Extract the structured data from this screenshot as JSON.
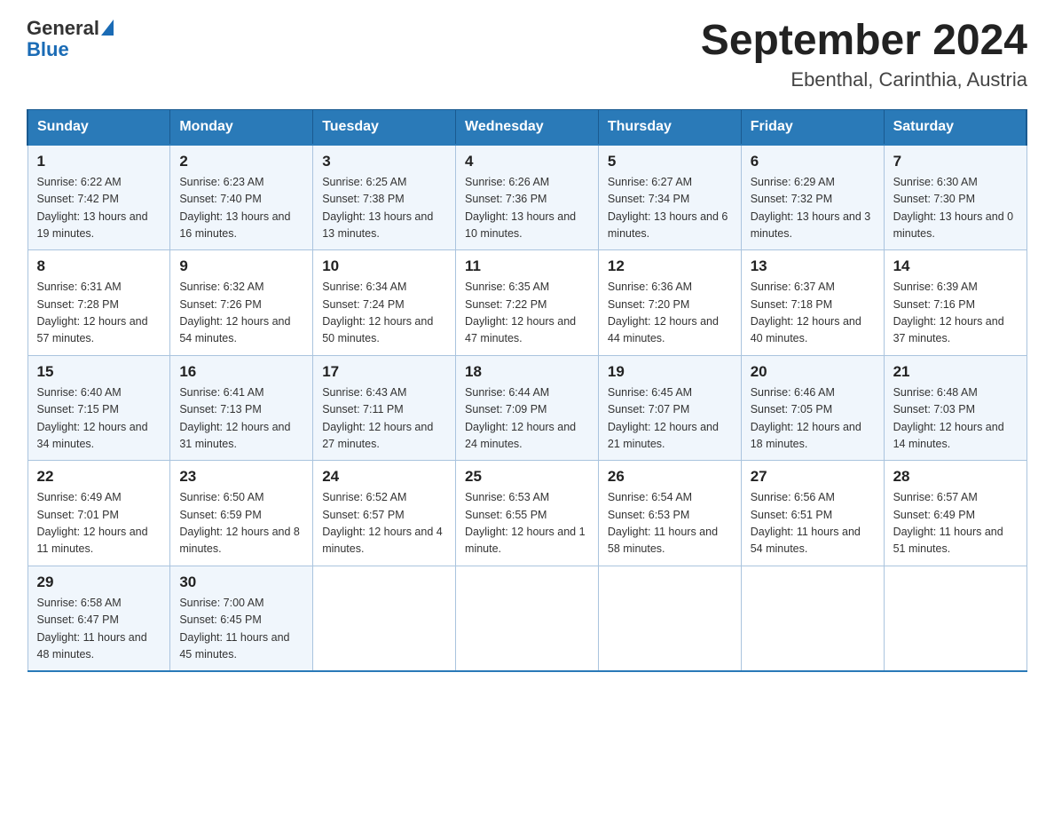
{
  "header": {
    "logo_general": "General",
    "logo_blue": "Blue",
    "title": "September 2024",
    "subtitle": "Ebenthal, Carinthia, Austria"
  },
  "days_of_week": [
    "Sunday",
    "Monday",
    "Tuesday",
    "Wednesday",
    "Thursday",
    "Friday",
    "Saturday"
  ],
  "weeks": [
    [
      {
        "day": "1",
        "sunrise": "Sunrise: 6:22 AM",
        "sunset": "Sunset: 7:42 PM",
        "daylight": "Daylight: 13 hours and 19 minutes."
      },
      {
        "day": "2",
        "sunrise": "Sunrise: 6:23 AM",
        "sunset": "Sunset: 7:40 PM",
        "daylight": "Daylight: 13 hours and 16 minutes."
      },
      {
        "day": "3",
        "sunrise": "Sunrise: 6:25 AM",
        "sunset": "Sunset: 7:38 PM",
        "daylight": "Daylight: 13 hours and 13 minutes."
      },
      {
        "day": "4",
        "sunrise": "Sunrise: 6:26 AM",
        "sunset": "Sunset: 7:36 PM",
        "daylight": "Daylight: 13 hours and 10 minutes."
      },
      {
        "day": "5",
        "sunrise": "Sunrise: 6:27 AM",
        "sunset": "Sunset: 7:34 PM",
        "daylight": "Daylight: 13 hours and 6 minutes."
      },
      {
        "day": "6",
        "sunrise": "Sunrise: 6:29 AM",
        "sunset": "Sunset: 7:32 PM",
        "daylight": "Daylight: 13 hours and 3 minutes."
      },
      {
        "day": "7",
        "sunrise": "Sunrise: 6:30 AM",
        "sunset": "Sunset: 7:30 PM",
        "daylight": "Daylight: 13 hours and 0 minutes."
      }
    ],
    [
      {
        "day": "8",
        "sunrise": "Sunrise: 6:31 AM",
        "sunset": "Sunset: 7:28 PM",
        "daylight": "Daylight: 12 hours and 57 minutes."
      },
      {
        "day": "9",
        "sunrise": "Sunrise: 6:32 AM",
        "sunset": "Sunset: 7:26 PM",
        "daylight": "Daylight: 12 hours and 54 minutes."
      },
      {
        "day": "10",
        "sunrise": "Sunrise: 6:34 AM",
        "sunset": "Sunset: 7:24 PM",
        "daylight": "Daylight: 12 hours and 50 minutes."
      },
      {
        "day": "11",
        "sunrise": "Sunrise: 6:35 AM",
        "sunset": "Sunset: 7:22 PM",
        "daylight": "Daylight: 12 hours and 47 minutes."
      },
      {
        "day": "12",
        "sunrise": "Sunrise: 6:36 AM",
        "sunset": "Sunset: 7:20 PM",
        "daylight": "Daylight: 12 hours and 44 minutes."
      },
      {
        "day": "13",
        "sunrise": "Sunrise: 6:37 AM",
        "sunset": "Sunset: 7:18 PM",
        "daylight": "Daylight: 12 hours and 40 minutes."
      },
      {
        "day": "14",
        "sunrise": "Sunrise: 6:39 AM",
        "sunset": "Sunset: 7:16 PM",
        "daylight": "Daylight: 12 hours and 37 minutes."
      }
    ],
    [
      {
        "day": "15",
        "sunrise": "Sunrise: 6:40 AM",
        "sunset": "Sunset: 7:15 PM",
        "daylight": "Daylight: 12 hours and 34 minutes."
      },
      {
        "day": "16",
        "sunrise": "Sunrise: 6:41 AM",
        "sunset": "Sunset: 7:13 PM",
        "daylight": "Daylight: 12 hours and 31 minutes."
      },
      {
        "day": "17",
        "sunrise": "Sunrise: 6:43 AM",
        "sunset": "Sunset: 7:11 PM",
        "daylight": "Daylight: 12 hours and 27 minutes."
      },
      {
        "day": "18",
        "sunrise": "Sunrise: 6:44 AM",
        "sunset": "Sunset: 7:09 PM",
        "daylight": "Daylight: 12 hours and 24 minutes."
      },
      {
        "day": "19",
        "sunrise": "Sunrise: 6:45 AM",
        "sunset": "Sunset: 7:07 PM",
        "daylight": "Daylight: 12 hours and 21 minutes."
      },
      {
        "day": "20",
        "sunrise": "Sunrise: 6:46 AM",
        "sunset": "Sunset: 7:05 PM",
        "daylight": "Daylight: 12 hours and 18 minutes."
      },
      {
        "day": "21",
        "sunrise": "Sunrise: 6:48 AM",
        "sunset": "Sunset: 7:03 PM",
        "daylight": "Daylight: 12 hours and 14 minutes."
      }
    ],
    [
      {
        "day": "22",
        "sunrise": "Sunrise: 6:49 AM",
        "sunset": "Sunset: 7:01 PM",
        "daylight": "Daylight: 12 hours and 11 minutes."
      },
      {
        "day": "23",
        "sunrise": "Sunrise: 6:50 AM",
        "sunset": "Sunset: 6:59 PM",
        "daylight": "Daylight: 12 hours and 8 minutes."
      },
      {
        "day": "24",
        "sunrise": "Sunrise: 6:52 AM",
        "sunset": "Sunset: 6:57 PM",
        "daylight": "Daylight: 12 hours and 4 minutes."
      },
      {
        "day": "25",
        "sunrise": "Sunrise: 6:53 AM",
        "sunset": "Sunset: 6:55 PM",
        "daylight": "Daylight: 12 hours and 1 minute."
      },
      {
        "day": "26",
        "sunrise": "Sunrise: 6:54 AM",
        "sunset": "Sunset: 6:53 PM",
        "daylight": "Daylight: 11 hours and 58 minutes."
      },
      {
        "day": "27",
        "sunrise": "Sunrise: 6:56 AM",
        "sunset": "Sunset: 6:51 PM",
        "daylight": "Daylight: 11 hours and 54 minutes."
      },
      {
        "day": "28",
        "sunrise": "Sunrise: 6:57 AM",
        "sunset": "Sunset: 6:49 PM",
        "daylight": "Daylight: 11 hours and 51 minutes."
      }
    ],
    [
      {
        "day": "29",
        "sunrise": "Sunrise: 6:58 AM",
        "sunset": "Sunset: 6:47 PM",
        "daylight": "Daylight: 11 hours and 48 minutes."
      },
      {
        "day": "30",
        "sunrise": "Sunrise: 7:00 AM",
        "sunset": "Sunset: 6:45 PM",
        "daylight": "Daylight: 11 hours and 45 minutes."
      },
      null,
      null,
      null,
      null,
      null
    ]
  ]
}
